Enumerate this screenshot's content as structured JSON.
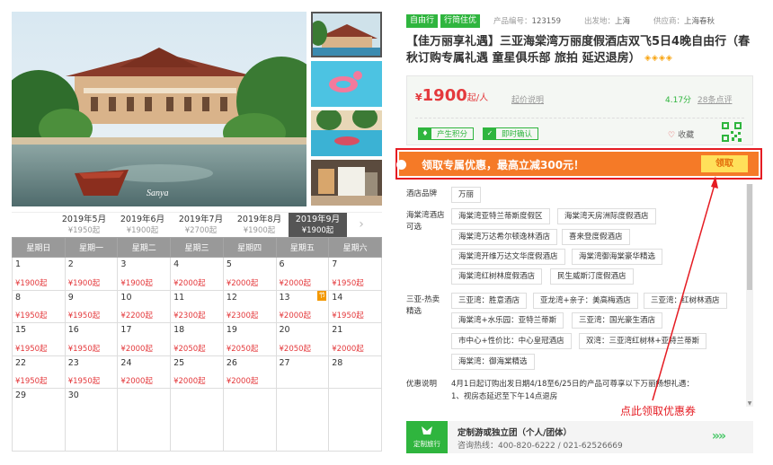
{
  "gallery": {
    "watermark": "Sanya",
    "thumbnail_count": 4
  },
  "months": [
    {
      "label": "2019年5月",
      "price": "¥1950起",
      "active": false
    },
    {
      "label": "2019年6月",
      "price": "¥1900起",
      "active": false
    },
    {
      "label": "2019年7月",
      "price": "¥2700起",
      "active": false
    },
    {
      "label": "2019年8月",
      "price": "¥1900起",
      "active": false
    },
    {
      "label": "2019年9月",
      "price": "¥1900起",
      "active": true
    }
  ],
  "month_next": "›",
  "calendar": {
    "weekdays": [
      "星期日",
      "星期一",
      "星期二",
      "星期三",
      "星期四",
      "星期五",
      "星期六"
    ],
    "weeks": [
      [
        {
          "d": "1",
          "p": "¥1900起"
        },
        {
          "d": "2",
          "p": "¥1900起"
        },
        {
          "d": "3",
          "p": "¥1900起"
        },
        {
          "d": "4",
          "p": "¥2000起"
        },
        {
          "d": "5",
          "p": "¥2000起"
        },
        {
          "d": "6",
          "p": "¥2000起"
        },
        {
          "d": "7",
          "p": "¥1950起"
        }
      ],
      [
        {
          "d": "8",
          "p": "¥1950起"
        },
        {
          "d": "9",
          "p": "¥1950起"
        },
        {
          "d": "10",
          "p": "¥2200起"
        },
        {
          "d": "11",
          "p": "¥2300起"
        },
        {
          "d": "12",
          "p": "¥2300起"
        },
        {
          "d": "13",
          "p": "¥2000起",
          "flag": "节"
        },
        {
          "d": "14",
          "p": "¥1950起"
        }
      ],
      [
        {
          "d": "15",
          "p": "¥1950起"
        },
        {
          "d": "16",
          "p": "¥1950起"
        },
        {
          "d": "17",
          "p": "¥2000起"
        },
        {
          "d": "18",
          "p": "¥2050起"
        },
        {
          "d": "19",
          "p": "¥2050起"
        },
        {
          "d": "20",
          "p": "¥2050起"
        },
        {
          "d": "21",
          "p": "¥2000起"
        }
      ],
      [
        {
          "d": "22",
          "p": "¥1950起"
        },
        {
          "d": "23",
          "p": "¥1950起"
        },
        {
          "d": "24",
          "p": "¥2000起"
        },
        {
          "d": "25",
          "p": "¥2000起"
        },
        {
          "d": "26",
          "p": "¥2000起"
        },
        {
          "d": "27",
          "p": ""
        },
        {
          "d": "28",
          "p": ""
        }
      ],
      [
        {
          "d": "29",
          "p": ""
        },
        {
          "d": "30",
          "p": ""
        },
        {
          "d": "",
          "p": ""
        },
        {
          "d": "",
          "p": ""
        },
        {
          "d": "",
          "p": ""
        },
        {
          "d": "",
          "p": ""
        },
        {
          "d": "",
          "p": ""
        }
      ]
    ]
  },
  "product": {
    "tag1": "自由行",
    "tag2": "行简住优",
    "code_label": "产品编号：",
    "code": "123159",
    "origin_label": "出发地：",
    "origin": "上海",
    "supplier_label": "供应商：",
    "supplier": "上海春秋",
    "title": "【佳万丽享礼遇】三亚海棠湾万丽度假酒店双飞5日4晚自由行（春秋订购专属礼遇 童星俱乐部 旅拍 延迟退房）",
    "diamonds": "◈◈◈◈",
    "price_currency": "¥",
    "price": "1900",
    "price_unit": "起/人",
    "price_link": "起价说明",
    "score": "4.17分",
    "reviews": "28条点评",
    "badge1": "产生积分",
    "badge2": "即时确认",
    "favorite": "收藏"
  },
  "promo": {
    "text": "领取专属优惠，最高立减300元！",
    "button": "领取"
  },
  "details": {
    "brand_label": "酒店品牌",
    "brand": "万丽",
    "alt_label_line1": "海棠湾酒店",
    "alt_label_line2": "可选",
    "alt_hotels": [
      "海棠湾亚特兰蒂斯度假区",
      "海棠湾天房洲际度假酒店",
      "海棠湾万达希尔顿逸林酒店",
      "喜来登度假酒店",
      "海棠湾开维万达文华度假酒店",
      "海棠湾御海棠豪华精选",
      "海棠湾红树林度假酒店",
      "民生威斯汀度假酒店"
    ],
    "hot_label_line1": "三亚-热卖",
    "hot_label_line2": "精选",
    "hot_picks": [
      "三亚湾：胜意酒店",
      "亚龙湾+亲子：美高梅酒店",
      "三亚湾：红树林酒店",
      "海棠湾+水乐园：亚特兰蒂斯",
      "三亚湾：国光豪生酒店",
      "市中心+性价比：中心皇冠酒店",
      "双湾：三亚湾红树林+亚特兰蒂斯",
      "海棠湾：御海棠精选"
    ],
    "offer_label": "优惠说明",
    "offer_line1": "4月1日起订购出发日期4/18至6/25日的产品可尊享以下万丽畅想礼遇：",
    "offer_line2": "1、视房态延迟至下午14点退房"
  },
  "custom": {
    "badge": "定制旅行",
    "title": "定制游或独立团（个人/团体）",
    "phone": "咨询热线：400-820-6222 / 021-62526669",
    "arrow": "»»"
  },
  "annotation": "点此领取优惠券",
  "colors": {
    "accent_green": "#2fb53e",
    "price_red": "#e4393c",
    "promo_orange": "#f57a27",
    "annotation_red": "#e51c23"
  }
}
